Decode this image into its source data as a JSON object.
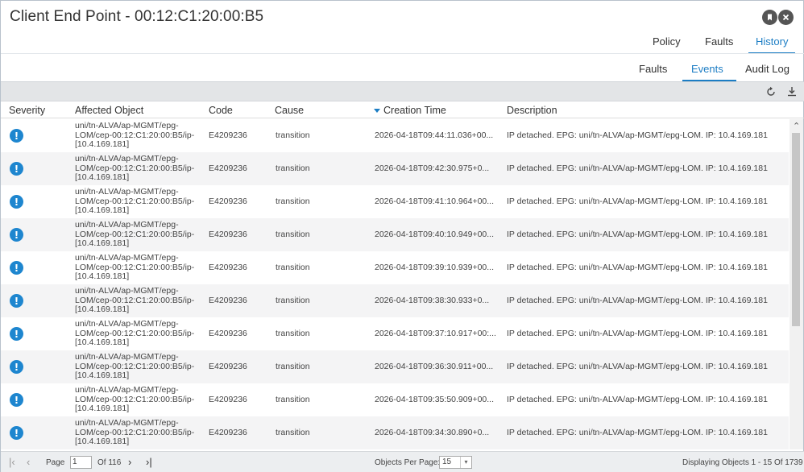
{
  "window": {
    "title": "Client End Point - 00:12:C1:20:00:B5"
  },
  "tabs_primary": [
    {
      "label": "Policy",
      "active": false
    },
    {
      "label": "Faults",
      "active": false
    },
    {
      "label": "History",
      "active": true
    }
  ],
  "tabs_secondary": [
    {
      "label": "Faults",
      "active": false
    },
    {
      "label": "Events",
      "active": true
    },
    {
      "label": "Audit Log",
      "active": false
    }
  ],
  "toolbar": {
    "icons": [
      "refresh-icon",
      "download-icon"
    ]
  },
  "table": {
    "columns": [
      "Severity",
      "Affected Object",
      "Code",
      "Cause",
      "Creation Time",
      "Description"
    ],
    "sorted_column": "Creation Time",
    "sort_direction": "descending",
    "rows": [
      {
        "severity": "!",
        "object": "uni/tn-ALVA/ap-MGMT/epg-LOM/cep-00:12:C1:20:00:B5/ip-[10.4.169.181]",
        "code": "E4209236",
        "cause": "transition",
        "time": "2026-04-18T09:44:11.036+00...",
        "description": "IP detached. EPG: uni/tn-ALVA/ap-MGMT/epg-LOM. IP: 10.4.169.181"
      },
      {
        "severity": "!",
        "object": "uni/tn-ALVA/ap-MGMT/epg-LOM/cep-00:12:C1:20:00:B5/ip-[10.4.169.181]",
        "code": "E4209236",
        "cause": "transition",
        "time": "2026-04-18T09:42:30.975+0...",
        "description": "IP detached. EPG: uni/tn-ALVA/ap-MGMT/epg-LOM. IP: 10.4.169.181"
      },
      {
        "severity": "!",
        "object": "uni/tn-ALVA/ap-MGMT/epg-LOM/cep-00:12:C1:20:00:B5/ip-[10.4.169.181]",
        "code": "E4209236",
        "cause": "transition",
        "time": "2026-04-18T09:41:10.964+00...",
        "description": "IP detached. EPG: uni/tn-ALVA/ap-MGMT/epg-LOM. IP: 10.4.169.181"
      },
      {
        "severity": "!",
        "object": "uni/tn-ALVA/ap-MGMT/epg-LOM/cep-00:12:C1:20:00:B5/ip-[10.4.169.181]",
        "code": "E4209236",
        "cause": "transition",
        "time": "2026-04-18T09:40:10.949+00...",
        "description": "IP detached. EPG: uni/tn-ALVA/ap-MGMT/epg-LOM. IP: 10.4.169.181"
      },
      {
        "severity": "!",
        "object": "uni/tn-ALVA/ap-MGMT/epg-LOM/cep-00:12:C1:20:00:B5/ip-[10.4.169.181]",
        "code": "E4209236",
        "cause": "transition",
        "time": "2026-04-18T09:39:10.939+00...",
        "description": "IP detached. EPG: uni/tn-ALVA/ap-MGMT/epg-LOM. IP: 10.4.169.181"
      },
      {
        "severity": "!",
        "object": "uni/tn-ALVA/ap-MGMT/epg-LOM/cep-00:12:C1:20:00:B5/ip-[10.4.169.181]",
        "code": "E4209236",
        "cause": "transition",
        "time": "2026-04-18T09:38:30.933+0...",
        "description": "IP detached. EPG: uni/tn-ALVA/ap-MGMT/epg-LOM. IP: 10.4.169.181"
      },
      {
        "severity": "!",
        "object": "uni/tn-ALVA/ap-MGMT/epg-LOM/cep-00:12:C1:20:00:B5/ip-[10.4.169.181]",
        "code": "E4209236",
        "cause": "transition",
        "time": "2026-04-18T09:37:10.917+00:...",
        "description": "IP detached. EPG: uni/tn-ALVA/ap-MGMT/epg-LOM. IP: 10.4.169.181"
      },
      {
        "severity": "!",
        "object": "uni/tn-ALVA/ap-MGMT/epg-LOM/cep-00:12:C1:20:00:B5/ip-[10.4.169.181]",
        "code": "E4209236",
        "cause": "transition",
        "time": "2026-04-18T09:36:30.911+00...",
        "description": "IP detached. EPG: uni/tn-ALVA/ap-MGMT/epg-LOM. IP: 10.4.169.181"
      },
      {
        "severity": "!",
        "object": "uni/tn-ALVA/ap-MGMT/epg-LOM/cep-00:12:C1:20:00:B5/ip-[10.4.169.181]",
        "code": "E4209236",
        "cause": "transition",
        "time": "2026-04-18T09:35:50.909+00...",
        "description": "IP detached. EPG: uni/tn-ALVA/ap-MGMT/epg-LOM. IP: 10.4.169.181"
      },
      {
        "severity": "!",
        "object": "uni/tn-ALVA/ap-MGMT/epg-LOM/cep-00:12:C1:20:00:B5/ip-[10.4.169.181]",
        "code": "E4209236",
        "cause": "transition",
        "time": "2026-04-18T09:34:30.890+0...",
        "description": "IP detached. EPG: uni/tn-ALVA/ap-MGMT/epg-LOM. IP: 10.4.169.181"
      }
    ]
  },
  "footer": {
    "page_label": "Page",
    "page_value": "1",
    "of_label": "Of 116",
    "per_page_label": "Objects Per Page:",
    "per_page_value": "15",
    "displaying": "Displaying Objects 1 - 15 Of 1739"
  },
  "colors": {
    "accent": "#1c7dc4",
    "severity_info": "#1e86cf",
    "toolbar_bg": "#e3e5e7",
    "row_alt": "#f4f4f5"
  }
}
